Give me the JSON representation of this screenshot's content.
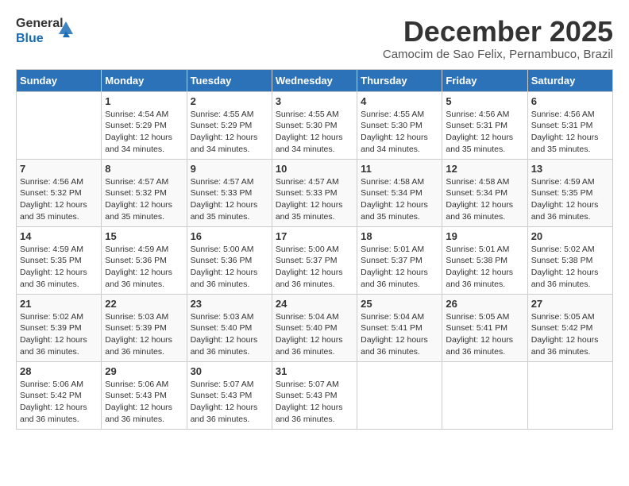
{
  "logo": {
    "line1": "General",
    "line2": "Blue"
  },
  "header": {
    "month": "December 2025",
    "location": "Camocim de Sao Felix, Pernambuco, Brazil"
  },
  "weekdays": [
    "Sunday",
    "Monday",
    "Tuesday",
    "Wednesday",
    "Thursday",
    "Friday",
    "Saturday"
  ],
  "weeks": [
    [
      {
        "day": "",
        "sunrise": "",
        "sunset": "",
        "daylight": ""
      },
      {
        "day": "1",
        "sunrise": "Sunrise: 4:54 AM",
        "sunset": "Sunset: 5:29 PM",
        "daylight": "Daylight: 12 hours and 34 minutes."
      },
      {
        "day": "2",
        "sunrise": "Sunrise: 4:55 AM",
        "sunset": "Sunset: 5:29 PM",
        "daylight": "Daylight: 12 hours and 34 minutes."
      },
      {
        "day": "3",
        "sunrise": "Sunrise: 4:55 AM",
        "sunset": "Sunset: 5:30 PM",
        "daylight": "Daylight: 12 hours and 34 minutes."
      },
      {
        "day": "4",
        "sunrise": "Sunrise: 4:55 AM",
        "sunset": "Sunset: 5:30 PM",
        "daylight": "Daylight: 12 hours and 34 minutes."
      },
      {
        "day": "5",
        "sunrise": "Sunrise: 4:56 AM",
        "sunset": "Sunset: 5:31 PM",
        "daylight": "Daylight: 12 hours and 35 minutes."
      },
      {
        "day": "6",
        "sunrise": "Sunrise: 4:56 AM",
        "sunset": "Sunset: 5:31 PM",
        "daylight": "Daylight: 12 hours and 35 minutes."
      }
    ],
    [
      {
        "day": "7",
        "sunrise": "Sunrise: 4:56 AM",
        "sunset": "Sunset: 5:32 PM",
        "daylight": "Daylight: 12 hours and 35 minutes."
      },
      {
        "day": "8",
        "sunrise": "Sunrise: 4:57 AM",
        "sunset": "Sunset: 5:32 PM",
        "daylight": "Daylight: 12 hours and 35 minutes."
      },
      {
        "day": "9",
        "sunrise": "Sunrise: 4:57 AM",
        "sunset": "Sunset: 5:33 PM",
        "daylight": "Daylight: 12 hours and 35 minutes."
      },
      {
        "day": "10",
        "sunrise": "Sunrise: 4:57 AM",
        "sunset": "Sunset: 5:33 PM",
        "daylight": "Daylight: 12 hours and 35 minutes."
      },
      {
        "day": "11",
        "sunrise": "Sunrise: 4:58 AM",
        "sunset": "Sunset: 5:34 PM",
        "daylight": "Daylight: 12 hours and 35 minutes."
      },
      {
        "day": "12",
        "sunrise": "Sunrise: 4:58 AM",
        "sunset": "Sunset: 5:34 PM",
        "daylight": "Daylight: 12 hours and 36 minutes."
      },
      {
        "day": "13",
        "sunrise": "Sunrise: 4:59 AM",
        "sunset": "Sunset: 5:35 PM",
        "daylight": "Daylight: 12 hours and 36 minutes."
      }
    ],
    [
      {
        "day": "14",
        "sunrise": "Sunrise: 4:59 AM",
        "sunset": "Sunset: 5:35 PM",
        "daylight": "Daylight: 12 hours and 36 minutes."
      },
      {
        "day": "15",
        "sunrise": "Sunrise: 4:59 AM",
        "sunset": "Sunset: 5:36 PM",
        "daylight": "Daylight: 12 hours and 36 minutes."
      },
      {
        "day": "16",
        "sunrise": "Sunrise: 5:00 AM",
        "sunset": "Sunset: 5:36 PM",
        "daylight": "Daylight: 12 hours and 36 minutes."
      },
      {
        "day": "17",
        "sunrise": "Sunrise: 5:00 AM",
        "sunset": "Sunset: 5:37 PM",
        "daylight": "Daylight: 12 hours and 36 minutes."
      },
      {
        "day": "18",
        "sunrise": "Sunrise: 5:01 AM",
        "sunset": "Sunset: 5:37 PM",
        "daylight": "Daylight: 12 hours and 36 minutes."
      },
      {
        "day": "19",
        "sunrise": "Sunrise: 5:01 AM",
        "sunset": "Sunset: 5:38 PM",
        "daylight": "Daylight: 12 hours and 36 minutes."
      },
      {
        "day": "20",
        "sunrise": "Sunrise: 5:02 AM",
        "sunset": "Sunset: 5:38 PM",
        "daylight": "Daylight: 12 hours and 36 minutes."
      }
    ],
    [
      {
        "day": "21",
        "sunrise": "Sunrise: 5:02 AM",
        "sunset": "Sunset: 5:39 PM",
        "daylight": "Daylight: 12 hours and 36 minutes."
      },
      {
        "day": "22",
        "sunrise": "Sunrise: 5:03 AM",
        "sunset": "Sunset: 5:39 PM",
        "daylight": "Daylight: 12 hours and 36 minutes."
      },
      {
        "day": "23",
        "sunrise": "Sunrise: 5:03 AM",
        "sunset": "Sunset: 5:40 PM",
        "daylight": "Daylight: 12 hours and 36 minutes."
      },
      {
        "day": "24",
        "sunrise": "Sunrise: 5:04 AM",
        "sunset": "Sunset: 5:40 PM",
        "daylight": "Daylight: 12 hours and 36 minutes."
      },
      {
        "day": "25",
        "sunrise": "Sunrise: 5:04 AM",
        "sunset": "Sunset: 5:41 PM",
        "daylight": "Daylight: 12 hours and 36 minutes."
      },
      {
        "day": "26",
        "sunrise": "Sunrise: 5:05 AM",
        "sunset": "Sunset: 5:41 PM",
        "daylight": "Daylight: 12 hours and 36 minutes."
      },
      {
        "day": "27",
        "sunrise": "Sunrise: 5:05 AM",
        "sunset": "Sunset: 5:42 PM",
        "daylight": "Daylight: 12 hours and 36 minutes."
      }
    ],
    [
      {
        "day": "28",
        "sunrise": "Sunrise: 5:06 AM",
        "sunset": "Sunset: 5:42 PM",
        "daylight": "Daylight: 12 hours and 36 minutes."
      },
      {
        "day": "29",
        "sunrise": "Sunrise: 5:06 AM",
        "sunset": "Sunset: 5:43 PM",
        "daylight": "Daylight: 12 hours and 36 minutes."
      },
      {
        "day": "30",
        "sunrise": "Sunrise: 5:07 AM",
        "sunset": "Sunset: 5:43 PM",
        "daylight": "Daylight: 12 hours and 36 minutes."
      },
      {
        "day": "31",
        "sunrise": "Sunrise: 5:07 AM",
        "sunset": "Sunset: 5:43 PM",
        "daylight": "Daylight: 12 hours and 36 minutes."
      },
      {
        "day": "",
        "sunrise": "",
        "sunset": "",
        "daylight": ""
      },
      {
        "day": "",
        "sunrise": "",
        "sunset": "",
        "daylight": ""
      },
      {
        "day": "",
        "sunrise": "",
        "sunset": "",
        "daylight": ""
      }
    ]
  ]
}
